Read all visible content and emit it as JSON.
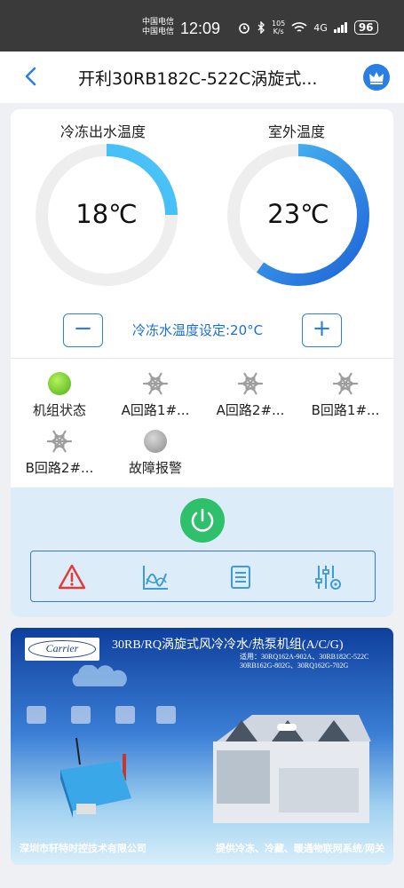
{
  "status_bar": {
    "carrier_1": "中国电信",
    "carrier_2": "中国电信",
    "time": "12:09",
    "net_speed_value": "105",
    "net_speed_unit": "K/s",
    "network_type": "4G",
    "battery": "96"
  },
  "header": {
    "title": "开利30RB182C-522C涡旋式..."
  },
  "gauges": [
    {
      "label": "冷冻出水温度",
      "value": "18℃",
      "fraction": 0.25,
      "color_start": "#29b6f6",
      "color_end": "#4fc3f7"
    },
    {
      "label": "室外温度",
      "value": "23℃",
      "fraction": 0.6,
      "color_start": "#1e63d6",
      "color_end": "#4fc3f7"
    }
  ],
  "setpoint": {
    "text": "冷冻水温度设定:20°C",
    "minus_label": "−",
    "plus_label": "+"
  },
  "status_items": [
    {
      "label": "机组状态",
      "icon": "green-dot-icon"
    },
    {
      "label": "A回路1#...",
      "icon": "snowflake-icon"
    },
    {
      "label": "A回路2#...",
      "icon": "snowflake-icon"
    },
    {
      "label": "B回路1#...",
      "icon": "snowflake-icon"
    },
    {
      "label": "B回路2#...",
      "icon": "snowflake-icon"
    },
    {
      "label": "故障报警",
      "icon": "gray-dot-icon"
    }
  ],
  "toolbar": {
    "items": [
      "alarm-icon",
      "trend-chart-icon",
      "list-icon",
      "settings-sliders-icon"
    ]
  },
  "banner": {
    "logo_text": "Carrier",
    "title": "30RB/RQ涡旋式风冷冷水/热泵机组(A/C/G)",
    "models": "适用：30RQ162A-902A、30RB182C-522C\n30RB162G-802G、30RQ162G-702G",
    "footer_left": "深圳市轩特时控技术有限公司",
    "footer_right": "提供冷冻、冷藏、暖通物联网系统/网关"
  },
  "colors": {
    "accent": "#2b7fe0",
    "power": "#2ec06a",
    "alarm": "#e53935",
    "panel_bg": "#dcedf9"
  }
}
